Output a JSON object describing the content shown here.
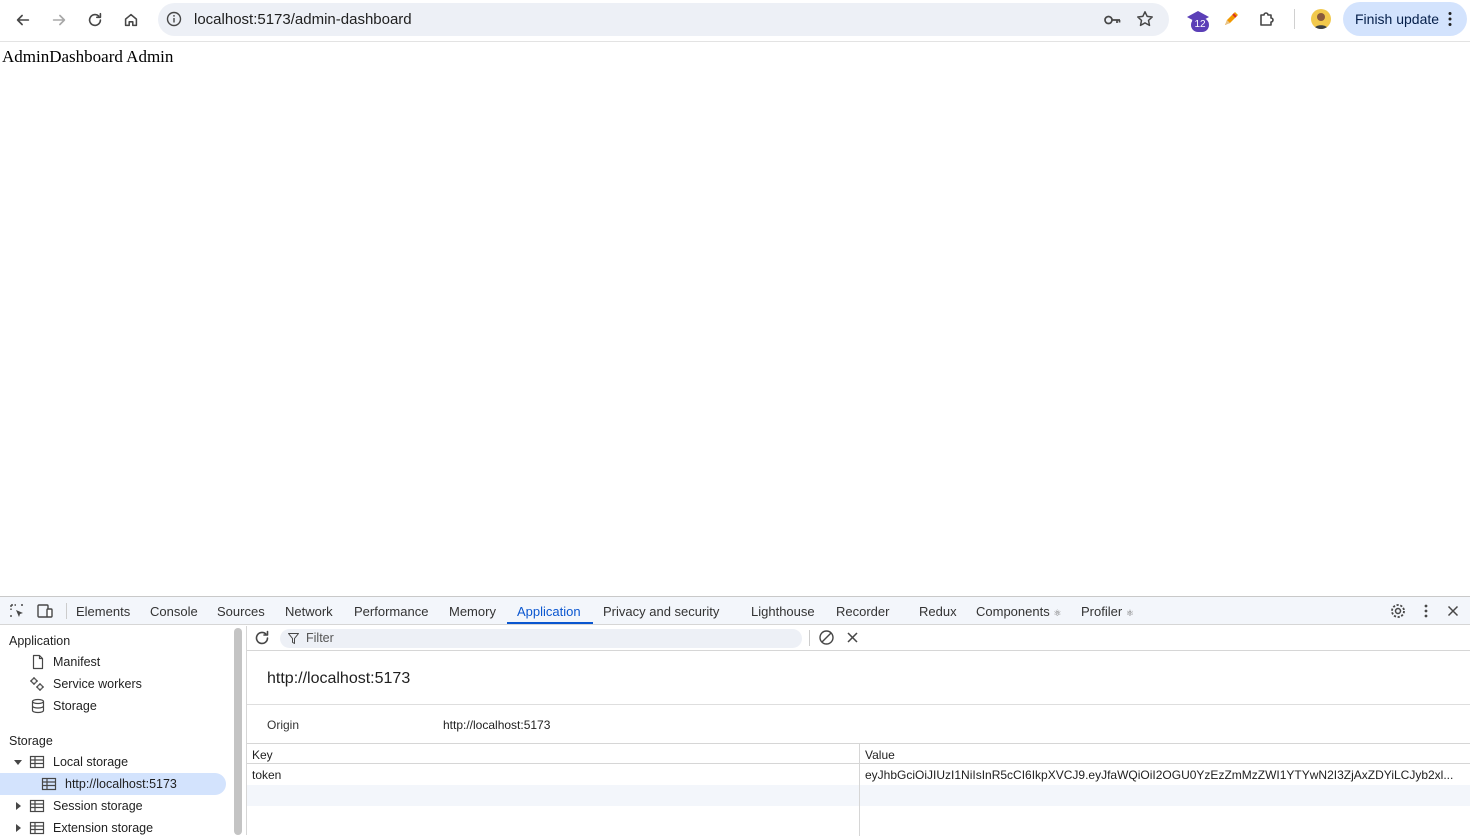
{
  "browser": {
    "url": "localhost:5173/admin-dashboard",
    "extension_badge": "12",
    "finish_update_label": "Finish update"
  },
  "page": {
    "text": "AdminDashboard Admin"
  },
  "devtools": {
    "tabs": [
      {
        "label": "Elements"
      },
      {
        "label": "Console"
      },
      {
        "label": "Sources"
      },
      {
        "label": "Network"
      },
      {
        "label": "Performance"
      },
      {
        "label": "Memory"
      },
      {
        "label": "Application",
        "active": true
      },
      {
        "label": "Privacy and security"
      },
      {
        "label": "Lighthouse"
      },
      {
        "label": "Recorder"
      },
      {
        "label": "Redux"
      },
      {
        "label": "Components"
      },
      {
        "label": "Profiler"
      }
    ],
    "sidebar": {
      "application_section": "Application",
      "application_items": [
        "Manifest",
        "Service workers",
        "Storage"
      ],
      "storage_section": "Storage",
      "local_storage": "Local storage",
      "local_storage_origin": "http://localhost:5173",
      "session_storage": "Session storage",
      "extension_storage": "Extension storage"
    },
    "toolbar": {
      "filter_placeholder": "Filter"
    },
    "storage_view": {
      "heading": "http://localhost:5173",
      "origin_label": "Origin",
      "origin_value": "http://localhost:5173",
      "columns": [
        "Key",
        "Value"
      ],
      "rows": [
        {
          "key": "token",
          "value": "eyJhbGciOiJIUzI1NiIsInR5cCI6IkpXVCJ9.eyJfaWQiOiI2OGU0YzEzZmMzZWI1YTYwN2I3ZjAxZDYiLCJyb2xl..."
        }
      ]
    }
  },
  "colors": {
    "accent": "#0b57d0",
    "selection": "#d3e3fd",
    "omnibox": "#edf0f6"
  }
}
